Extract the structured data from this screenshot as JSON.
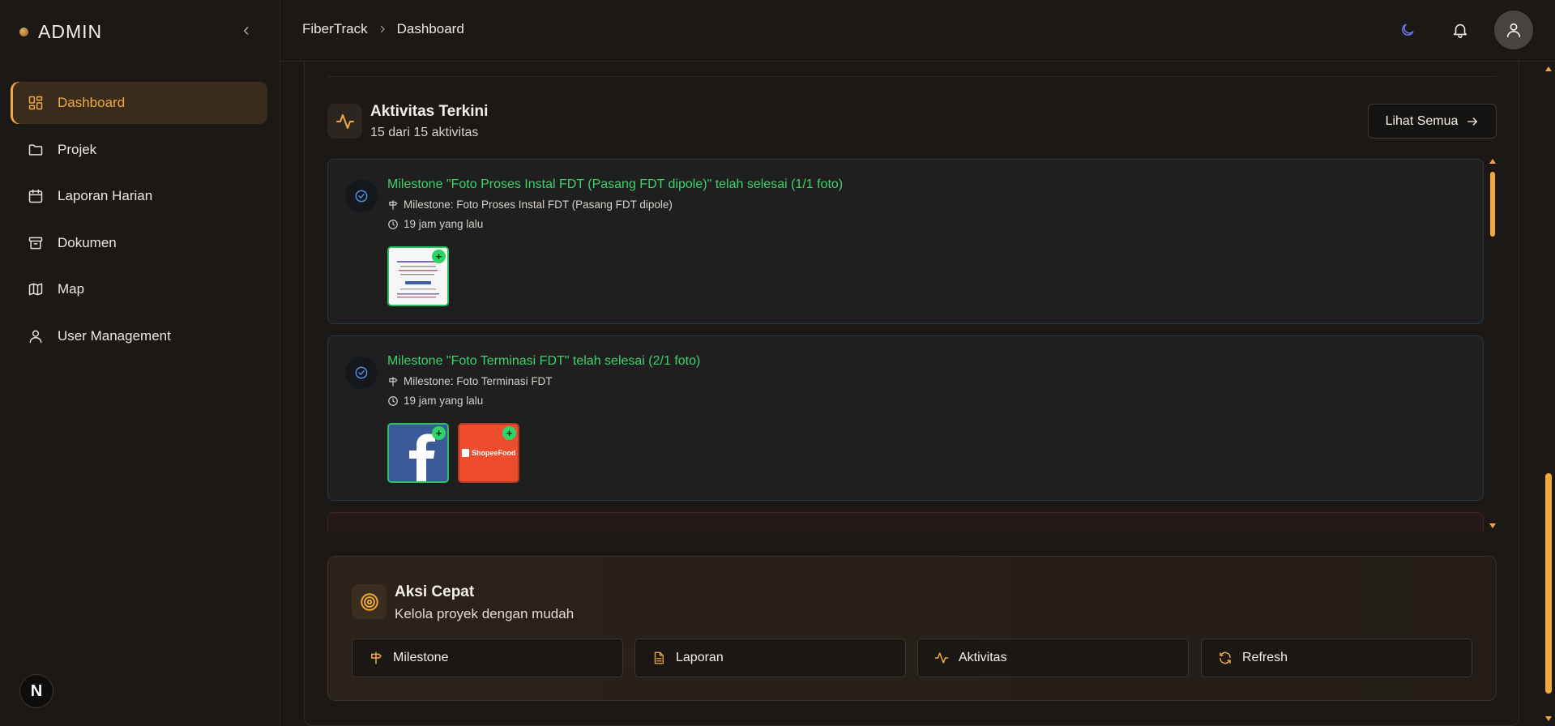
{
  "sidebar": {
    "brand": "ADMIN",
    "items": [
      {
        "label": "Dashboard",
        "icon": "grid-icon",
        "active": true
      },
      {
        "label": "Projek",
        "icon": "folder-icon"
      },
      {
        "label": "Laporan Harian",
        "icon": "calendar-icon"
      },
      {
        "label": "Dokumen",
        "icon": "archive-icon"
      },
      {
        "label": "Map",
        "icon": "map-icon"
      },
      {
        "label": "User Management",
        "icon": "user-icon"
      }
    ],
    "badge": "N"
  },
  "header": {
    "breadcrumb": [
      "FiberTrack",
      "Dashboard"
    ]
  },
  "activity": {
    "title": "Aktivitas Terkini",
    "subtitle": "15 dari 15 aktivitas",
    "see_all": "Lihat Semua",
    "items": [
      {
        "title": "Milestone \"Foto Proses Instal FDT (Pasang FDT dipole)\" telah selesai (1/1 foto)",
        "milestone": "Milestone: Foto Proses Instal FDT (Pasang FDT dipole)",
        "time": "19 jam yang lalu"
      },
      {
        "title": "Milestone \"Foto Terminasi FDT\" telah selesai (2/1 foto)",
        "milestone": "Milestone: Foto Terminasi FDT",
        "time": "19 jam yang lalu",
        "thumb_label": "ShopeeFood"
      }
    ]
  },
  "quick": {
    "title": "Aksi Cepat",
    "subtitle": "Kelola proyek dengan mudah",
    "buttons": [
      "Milestone",
      "Laporan",
      "Aktivitas",
      "Refresh"
    ]
  },
  "colors": {
    "accent": "#f1a93d",
    "success": "#3ed16a",
    "background": "#1b1815"
  }
}
